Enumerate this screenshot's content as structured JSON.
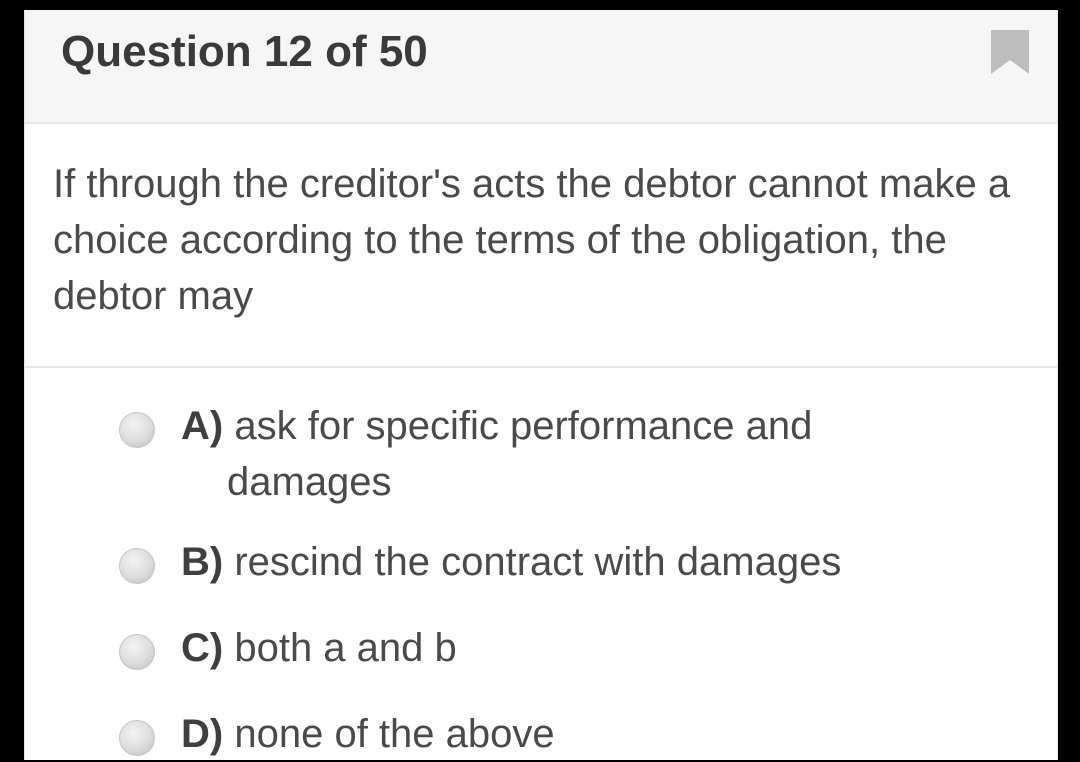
{
  "header": {
    "title": "Question 12 of 50",
    "bookmark_icon": "bookmark-icon"
  },
  "question": {
    "text": "If through the creditor's acts the debtor cannot make a choice according to the terms of the obligation, the debtor may"
  },
  "options": [
    {
      "letter": "A)",
      "line1": "ask for specific performance and",
      "line2": "damages"
    },
    {
      "letter": "B)",
      "line1": "rescind the contract with damages"
    },
    {
      "letter": "C)",
      "line1": "both a and b"
    },
    {
      "letter": "D)",
      "line1": "none of the above"
    }
  ],
  "colors": {
    "background": "#000000",
    "card": "#ffffff",
    "header": "#f6f6f6",
    "text": "#4a4a4a",
    "bookmark": "#bdbdbd"
  }
}
